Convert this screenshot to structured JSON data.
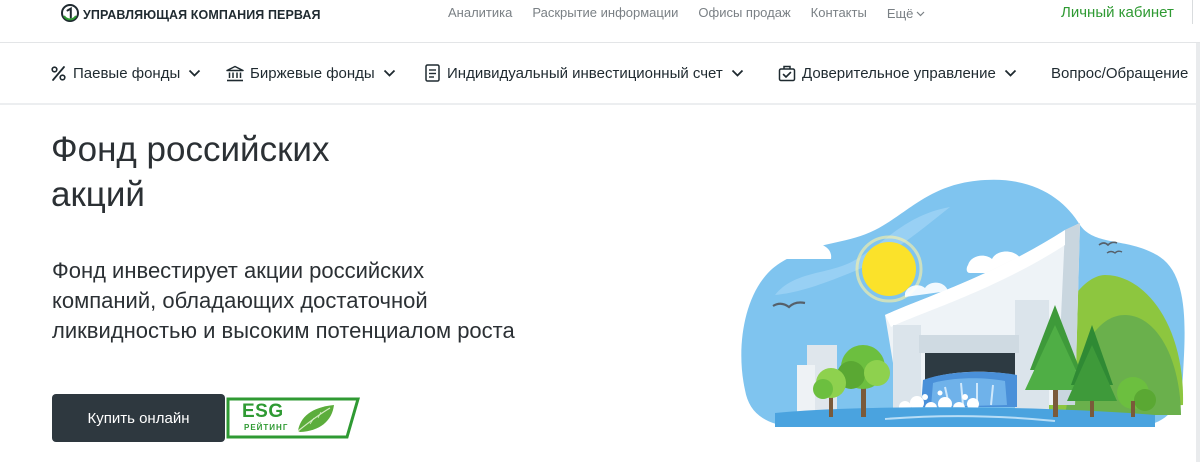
{
  "header": {
    "logo_text": "УПРАВЛЯЮЩАЯ КОМПАНИЯ ПЕРВАЯ",
    "top_links": [
      "Аналитика",
      "Раскрытие информации",
      "Офисы продаж",
      "Контакты"
    ],
    "more_label": "Ещё",
    "cabinet_label": "Личный кабинет"
  },
  "nav": {
    "items": [
      {
        "label": "Паевые фонды",
        "icon": "percent-icon"
      },
      {
        "label": "Биржевые фонды",
        "icon": "bank-building-icon"
      },
      {
        "label": "Индивидуальный инвестиционный счет",
        "icon": "document-icon"
      },
      {
        "label": "Доверительное управление",
        "icon": "briefcase-check-icon"
      }
    ],
    "last_label": "Вопрос/Обращение"
  },
  "hero": {
    "title_line1": "Фонд российских",
    "title_line2": "акций",
    "desc_line1": "Фонд инвестирует акции российских",
    "desc_line2": "компаний, обладающих достаточной",
    "desc_line3": "ликвидностью и высоким потенциалом роста",
    "buy_label": "Купить онлайн",
    "esg_label": "ESG",
    "esg_sub": "РЕЙТИНГ"
  },
  "colors": {
    "accent_green": "#2f9a33",
    "button_dark": "#2e383f",
    "text_dark": "#2b3034",
    "text_muted": "#7a8085"
  }
}
